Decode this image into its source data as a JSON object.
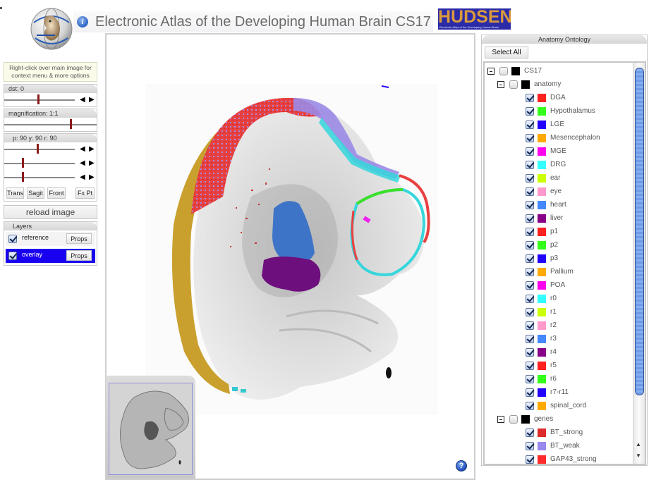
{
  "header": {
    "title": "Electronic Atlas of the Developing Human Brain CS17",
    "brand_logo_text": "HUDSEN",
    "brand_logo_subtext": "Electronic Atlas of the Developing Human Brain",
    "brand_color": "#2b2ba8",
    "brand_text_color": "#d99a3c"
  },
  "hint": {
    "line1": "Right-click over main image for",
    "line2": "context menu & more options"
  },
  "controls": {
    "distance": {
      "label": "dst: 0",
      "value": 0,
      "position_fraction": 0.47
    },
    "magnification": {
      "label": "magnification: 1:1",
      "value": "1:1",
      "position_fraction": 0.71
    },
    "orientation": {
      "label": "p: 90   y: 90   r: 90",
      "pitch": 90,
      "yaw": 90,
      "roll": 90,
      "pitch_fraction": 0.46,
      "yaw_fraction": 0.25,
      "roll_fraction": 0.25
    },
    "view_buttons": [
      "Trans",
      "Sagit",
      "Front"
    ],
    "fix_point_label": "Fx Pt",
    "reload_label": "reload image"
  },
  "layers": {
    "title": "Layers",
    "items": [
      {
        "name": "reference",
        "checked": true,
        "selected": false,
        "props_label": "Props"
      },
      {
        "name": "overlay",
        "checked": true,
        "selected": true,
        "props_label": "Props"
      }
    ],
    "selected_color": "#1a00f0"
  },
  "ontology": {
    "title": "Anatomy Ontology",
    "select_all_label": "Select All",
    "tree": [
      {
        "label": "CS17",
        "level": 0,
        "expander": true,
        "checked": false,
        "color": "#000000"
      },
      {
        "label": "anatomy",
        "level": 1,
        "expander": true,
        "checked": false,
        "color": "#000000"
      },
      {
        "label": "DGA",
        "level": 2,
        "checked": true,
        "color": "#ff2020"
      },
      {
        "label": "Hypothalamus",
        "level": 2,
        "checked": true,
        "color": "#33ff1a"
      },
      {
        "label": "LGE",
        "level": 2,
        "checked": true,
        "color": "#2200ff"
      },
      {
        "label": "Mesencephalon",
        "level": 2,
        "checked": true,
        "color": "#ffaa00"
      },
      {
        "label": "MGE",
        "level": 2,
        "checked": true,
        "color": "#ff00ee"
      },
      {
        "label": "DRG",
        "level": 2,
        "checked": true,
        "color": "#33ffff"
      },
      {
        "label": "ear",
        "level": 2,
        "checked": true,
        "color": "#ccff00"
      },
      {
        "label": "eye",
        "level": 2,
        "checked": true,
        "color": "#ff99cc"
      },
      {
        "label": "heart",
        "level": 2,
        "checked": true,
        "color": "#4488ff"
      },
      {
        "label": "liver",
        "level": 2,
        "checked": true,
        "color": "#880088"
      },
      {
        "label": "p1",
        "level": 2,
        "checked": true,
        "color": "#ff2020"
      },
      {
        "label": "p2",
        "level": 2,
        "checked": true,
        "color": "#33ff1a"
      },
      {
        "label": "p3",
        "level": 2,
        "checked": true,
        "color": "#2200ff"
      },
      {
        "label": "Pallium",
        "level": 2,
        "checked": true,
        "color": "#ffaa00"
      },
      {
        "label": "POA",
        "level": 2,
        "checked": true,
        "color": "#ff00ee"
      },
      {
        "label": "r0",
        "level": 2,
        "checked": true,
        "color": "#33ffff"
      },
      {
        "label": "r1",
        "level": 2,
        "checked": true,
        "color": "#ccff00"
      },
      {
        "label": "r2",
        "level": 2,
        "checked": true,
        "color": "#ff99cc"
      },
      {
        "label": "r3",
        "level": 2,
        "checked": true,
        "color": "#4488ff"
      },
      {
        "label": "r4",
        "level": 2,
        "checked": true,
        "color": "#880088"
      },
      {
        "label": "r5",
        "level": 2,
        "checked": true,
        "color": "#ff2020"
      },
      {
        "label": "r6",
        "level": 2,
        "checked": true,
        "color": "#33ff1a"
      },
      {
        "label": "r7-r11",
        "level": 2,
        "checked": true,
        "color": "#2200ff"
      },
      {
        "label": "spinal_cord",
        "level": 2,
        "checked": true,
        "color": "#ffaa00"
      },
      {
        "label": "genes",
        "level": 1,
        "expander": true,
        "checked": false,
        "color": "#000000"
      },
      {
        "label": "BT_strong",
        "level": 2,
        "checked": true,
        "color": "#dd2a2a"
      },
      {
        "label": "BT_weak",
        "level": 2,
        "checked": true,
        "color": "#9988ee"
      },
      {
        "label": "GAP43_strong",
        "level": 2,
        "checked": true,
        "color": "#ff2a2a"
      }
    ]
  },
  "help_icon_label": "?",
  "info_icon_label": "i"
}
